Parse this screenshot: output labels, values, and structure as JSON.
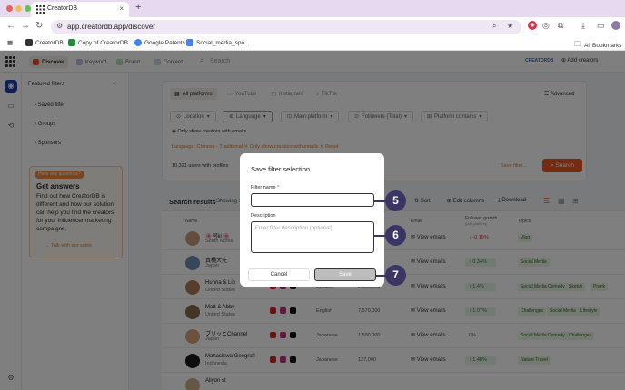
{
  "browser": {
    "tab_title": "CreatorDB",
    "url": "app.creatordb.app/discover",
    "bookmarks": [
      "CreatorDB",
      "Copy of CreatorDB...",
      "Google Patents",
      "Social_media_spo..."
    ],
    "all_bookmarks": "All Bookmarks"
  },
  "app": {
    "nav_tabs": [
      "Discover",
      "Keyword",
      "Brand",
      "Content"
    ],
    "search_placeholder": "Search",
    "brand_chip": "CREATORDB",
    "add_creators": "Add creators",
    "sidebar": {
      "title": "Featured filters",
      "items": [
        "Saved filter",
        "Groups",
        "Sponsors"
      ],
      "promo": {
        "badge": "Have any questions?",
        "title": "Get answers",
        "body": "Find out how CreatorDB is different and how our solution can help you find the creators for your influencer marketing campaigns.",
        "link": "Talk with our sales"
      }
    },
    "platform_tabs": [
      "All platforms",
      "YouTube",
      "Instagram",
      "TikTok"
    ],
    "advanced": "Advanced",
    "filter_chips": [
      "Location",
      "Language",
      "Main platform",
      "Followers (Total)",
      "Platform contains"
    ],
    "only_emails": "Only show creators with emails",
    "active_tags": "Language: Chinese - Traditional ✕    Only show creators with emails ✕   Reset",
    "users_count": "10,321 users with profiles",
    "save_filter": "Save filter...",
    "search_button": "Search",
    "results": {
      "title": "Search results",
      "showing": "Showing 1",
      "sort": "Sort",
      "edit_columns": "Edit columns",
      "download": "Download"
    },
    "table": {
      "headers": [
        "Name",
        "Email",
        "Follower growth",
        "Topics"
      ],
      "growth_sub": "(last platform)",
      "rows": [
        {
          "name": "🌸阿ki 🌸",
          "country": "South Korea",
          "language": "",
          "followers": "",
          "email": "View emails",
          "growth": "-0.19%",
          "topics": [
            "Vlog"
          ]
        },
        {
          "name": "真樋大先",
          "country": "Japan",
          "language": "",
          "followers": "",
          "email": "View emails",
          "growth": "0.34%",
          "topics": [
            "Social Media"
          ]
        },
        {
          "name": "Hunna & Lib",
          "country": "United States",
          "language": "English",
          "followers": "2,160,000",
          "email": "View emails",
          "growth": "1.4%",
          "topics": [
            "Social Media Comedy",
            "Sketch",
            "Prank"
          ]
        },
        {
          "name": "Matt & Abby",
          "country": "United States",
          "language": "English",
          "followers": "7,570,000",
          "email": "View emails",
          "growth": "1.07%",
          "topics": [
            "Challenges",
            "Social Media",
            "Lifestyle"
          ]
        },
        {
          "name": "ブリッとChannel",
          "country": "Japan",
          "language": "Japanese",
          "followers": "1,590,000",
          "email": "View emails",
          "growth": "0%",
          "topics": [
            "Social Media Comedy",
            "Challenges"
          ]
        },
        {
          "name": "Mahasiswa Geografi",
          "country": "Indonesia",
          "language": "Japanese",
          "followers": "127,000",
          "email": "View emails",
          "growth": "1.48%",
          "topics": [
            "Nature Travel"
          ]
        },
        {
          "name": "Aliyon st",
          "country": "",
          "language": "",
          "followers": "",
          "email": "",
          "growth": "",
          "topics": []
        }
      ]
    }
  },
  "modal": {
    "title": "Save filter selection",
    "name_label": "Filter name",
    "required_mark": "*",
    "name_value": "",
    "desc_label": "Description",
    "desc_placeholder": "Enter filter description (optional)",
    "cancel": "Cancel",
    "save": "Save"
  },
  "steps": [
    "5",
    "6",
    "7"
  ],
  "colors": {
    "accent_orange": "#e8572a",
    "step_badge": "#3b3566",
    "rail_active": "#1e40af"
  }
}
